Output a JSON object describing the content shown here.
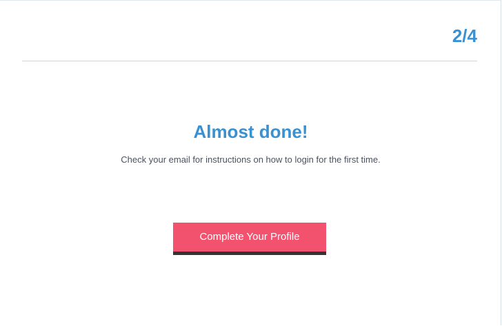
{
  "header": {
    "step": "2/4"
  },
  "main": {
    "title": "Almost done!",
    "message": "Check your email for instructions on how to login for the first time.",
    "button_label": "Complete Your Profile"
  },
  "colors": {
    "accent_blue": "#3a91d1",
    "button_pink": "#f2526e",
    "button_shadow": "#333338",
    "divider": "#d3d3d3",
    "text_gray": "#4a5260"
  }
}
